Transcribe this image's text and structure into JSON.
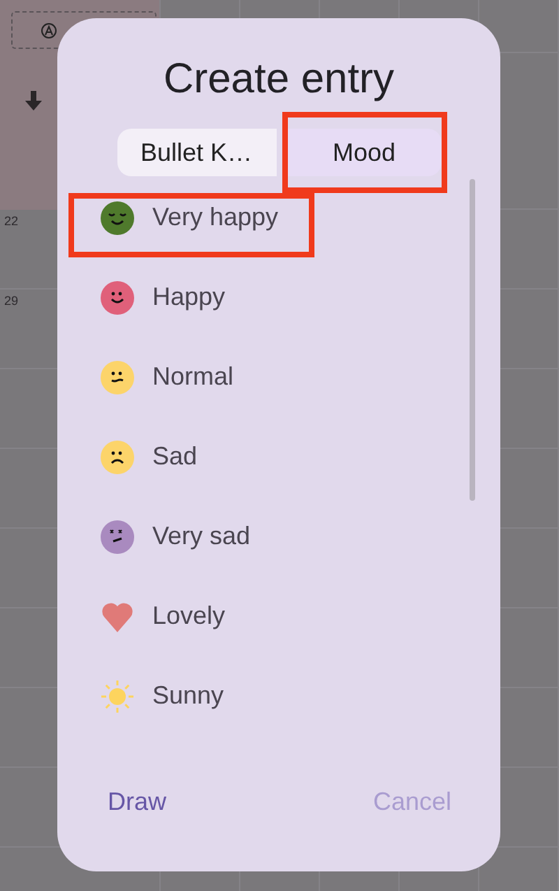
{
  "background": {
    "dates": [
      "22",
      "29"
    ]
  },
  "dialog": {
    "title": "Create entry",
    "tabs": [
      {
        "label": "Bullet K…",
        "selected": false,
        "highlighted": false
      },
      {
        "label": "Mood",
        "selected": true,
        "highlighted": true
      }
    ],
    "items": [
      {
        "label": "Very happy",
        "kind": "grin",
        "color": "#4f7a2c",
        "highlighted": true
      },
      {
        "label": "Happy",
        "kind": "smile",
        "color": "#e0607a",
        "highlighted": false
      },
      {
        "label": "Normal",
        "kind": "neutral",
        "color": "#fcd46a",
        "highlighted": false
      },
      {
        "label": "Sad",
        "kind": "frown",
        "color": "#fcd46a",
        "highlighted": false
      },
      {
        "label": "Very sad",
        "kind": "upset",
        "color": "#a98abf",
        "highlighted": false
      },
      {
        "label": "Lovely",
        "kind": "heart",
        "color": "#e07a78",
        "highlighted": false
      },
      {
        "label": "Sunny",
        "kind": "sun",
        "color": "#fdd45e",
        "highlighted": false
      }
    ],
    "buttons": [
      {
        "label": "Draw",
        "kind": "primary"
      },
      {
        "label": "Cancel",
        "kind": "secondary"
      }
    ]
  }
}
